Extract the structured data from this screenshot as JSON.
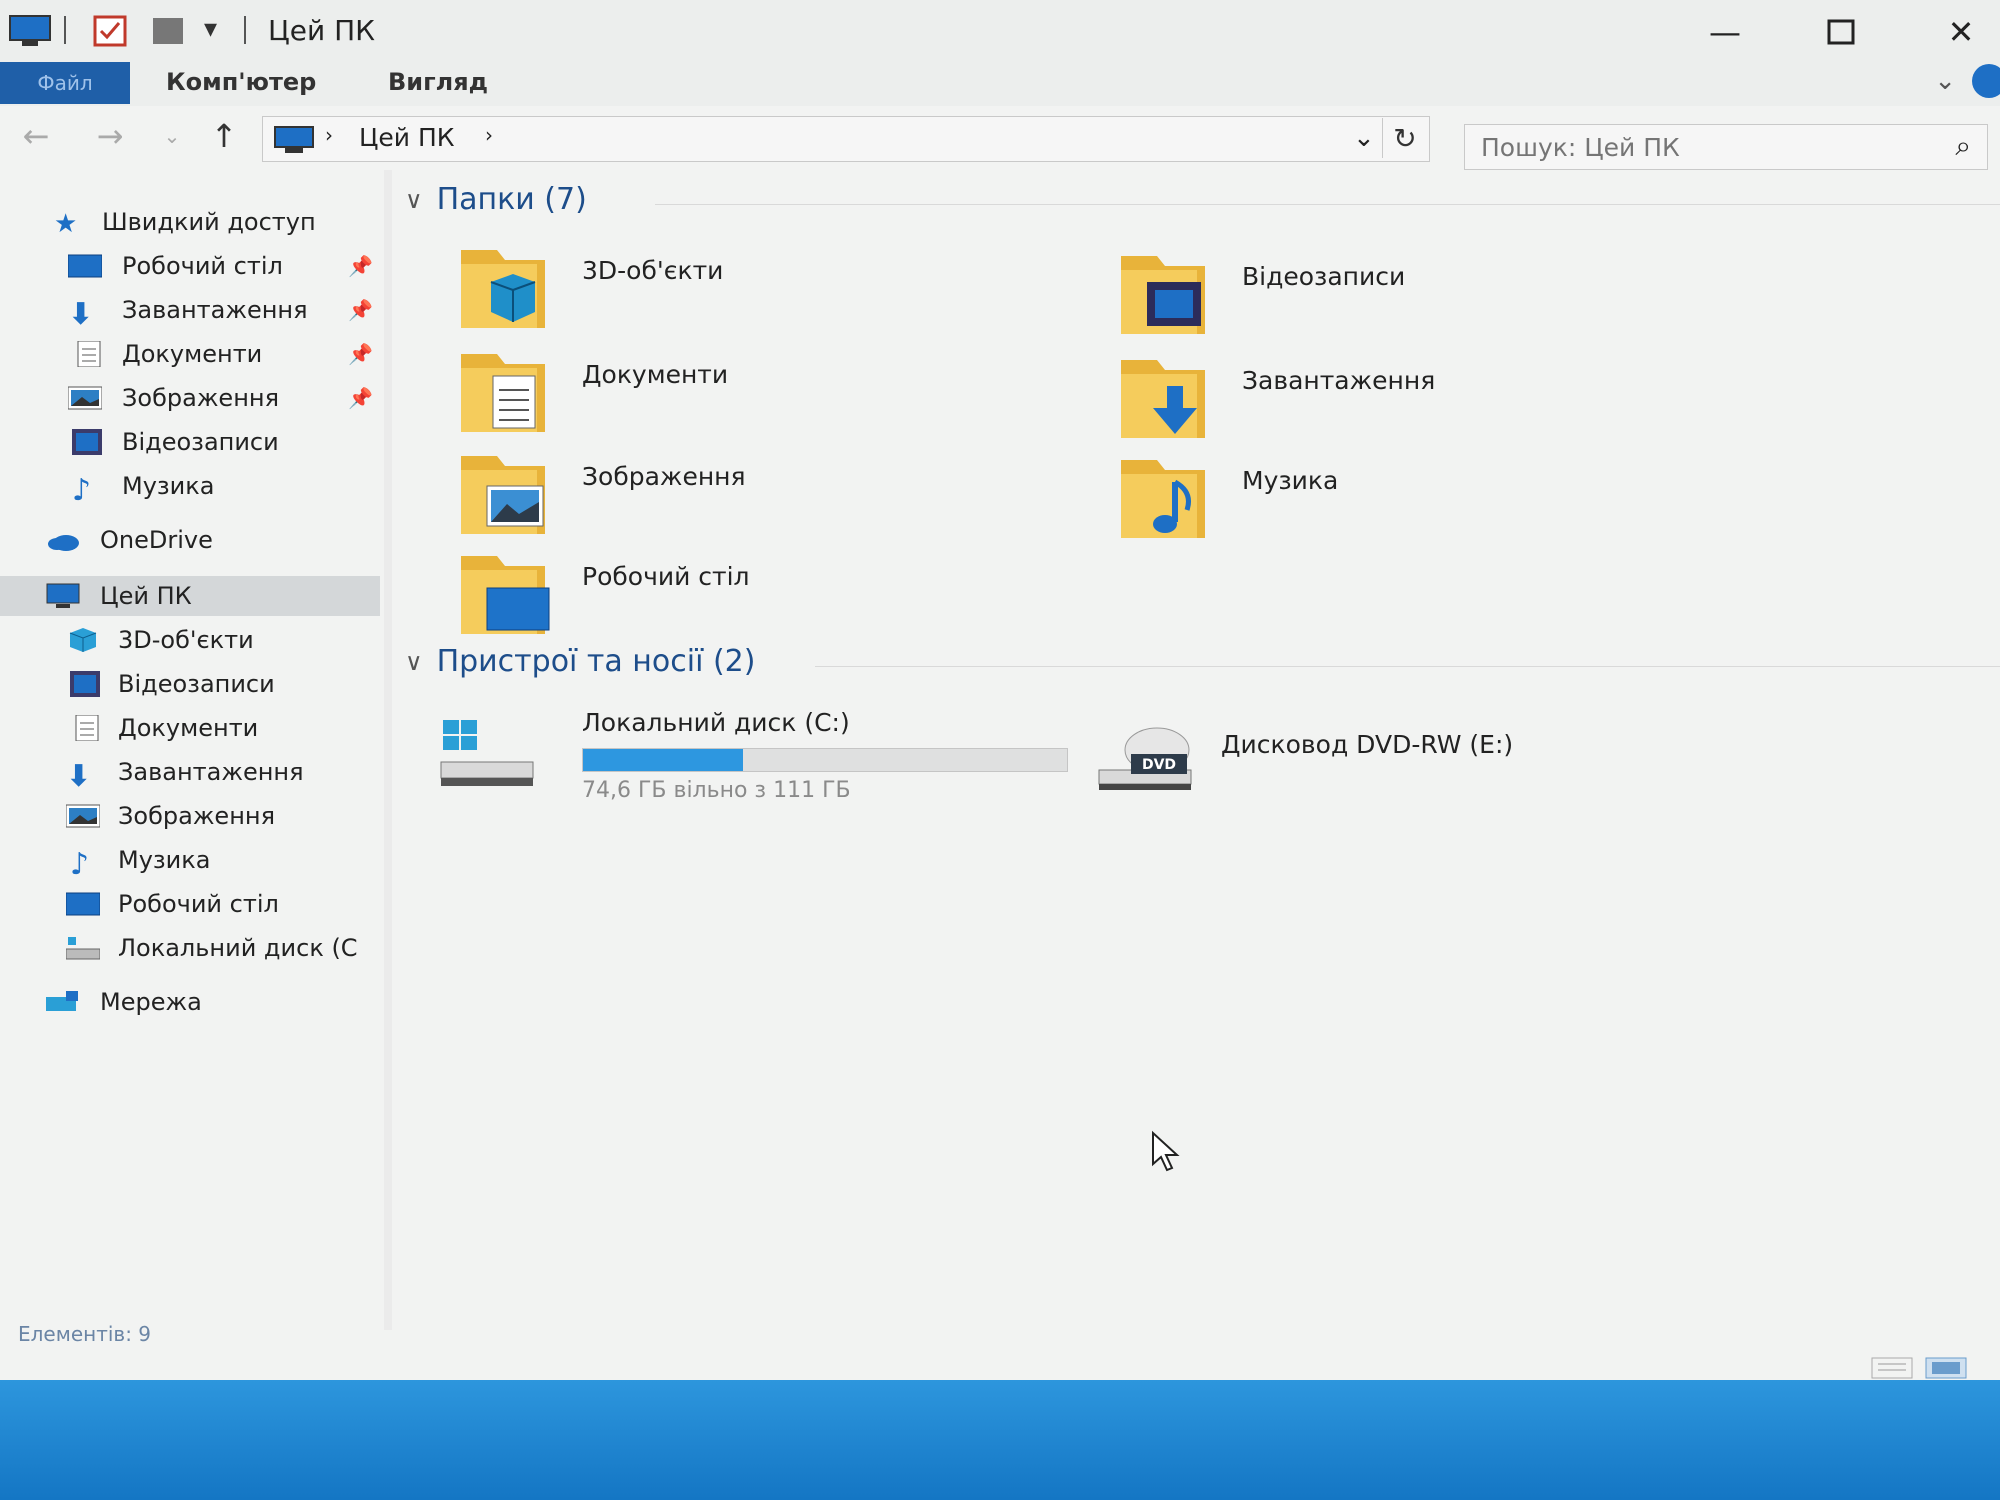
{
  "window": {
    "title": "Цей ПК",
    "qa_dropdown_icon": "quick-access-dropdown-icon"
  },
  "ribbon": {
    "file_tab": "Файл",
    "tabs": [
      {
        "label": "Комп'ютер"
      },
      {
        "label": "Вигляд"
      }
    ]
  },
  "address": {
    "crumbs": [
      "Цей ПК"
    ]
  },
  "search": {
    "placeholder": "Пошук: Цей ПК"
  },
  "sidebar": {
    "quick_access": "Швидкий доступ",
    "quick_items": [
      {
        "label": "Робочий стіл",
        "icon": "desktop-icon",
        "pinned": true
      },
      {
        "label": "Завантаження",
        "icon": "download-icon",
        "pinned": true
      },
      {
        "label": "Документи",
        "icon": "documents-icon",
        "pinned": true
      },
      {
        "label": "Зображення",
        "icon": "pictures-icon",
        "pinned": true
      },
      {
        "label": "Відеозаписи",
        "icon": "videos-icon",
        "pinned": false
      },
      {
        "label": "Музика",
        "icon": "music-icon",
        "pinned": false
      }
    ],
    "onedrive": "OneDrive",
    "this_pc": "Цей ПК",
    "pc_items": [
      {
        "label": "3D-об'єкти",
        "icon": "3d-objects-icon"
      },
      {
        "label": "Відеозаписи",
        "icon": "videos-icon"
      },
      {
        "label": "Документи",
        "icon": "documents-icon"
      },
      {
        "label": "Завантаження",
        "icon": "download-icon"
      },
      {
        "label": "Зображення",
        "icon": "pictures-icon"
      },
      {
        "label": "Музика",
        "icon": "music-icon"
      },
      {
        "label": "Робочий стіл",
        "icon": "desktop-icon"
      },
      {
        "label": "Локальний диск (C",
        "icon": "local-disk-icon"
      }
    ],
    "network": "Мережа"
  },
  "content": {
    "folders_header": "Папки (7)",
    "folders": [
      {
        "name": "3D-об'єкти",
        "icon": "3d-objects-folder-icon"
      },
      {
        "name": "Відеозаписи",
        "icon": "videos-folder-icon"
      },
      {
        "name": "Документи",
        "icon": "documents-folder-icon"
      },
      {
        "name": "Завантаження",
        "icon": "downloads-folder-icon"
      },
      {
        "name": "Зображення",
        "icon": "pictures-folder-icon"
      },
      {
        "name": "Музика",
        "icon": "music-folder-icon"
      },
      {
        "name": "Робочий стіл",
        "icon": "desktop-folder-icon"
      }
    ],
    "devices_header": "Пристрої та носії (2)",
    "drives": [
      {
        "name": "Локальний диск (C:)",
        "free_text": "74,6 ГБ вільно з 111 ГБ",
        "used_fraction": 0.33,
        "icon": "windows-drive-icon"
      },
      {
        "name": "Дисковод DVD-RW (E:)",
        "icon": "dvd-drive-icon",
        "badge": "DVD"
      }
    ]
  },
  "status": {
    "items_count": "Елементів: 9"
  },
  "colors": {
    "accent": "#1f5fa8",
    "folder": "#f2c14e",
    "drive_fill": "#2d97e0",
    "taskbar": "#1e8ad6"
  }
}
